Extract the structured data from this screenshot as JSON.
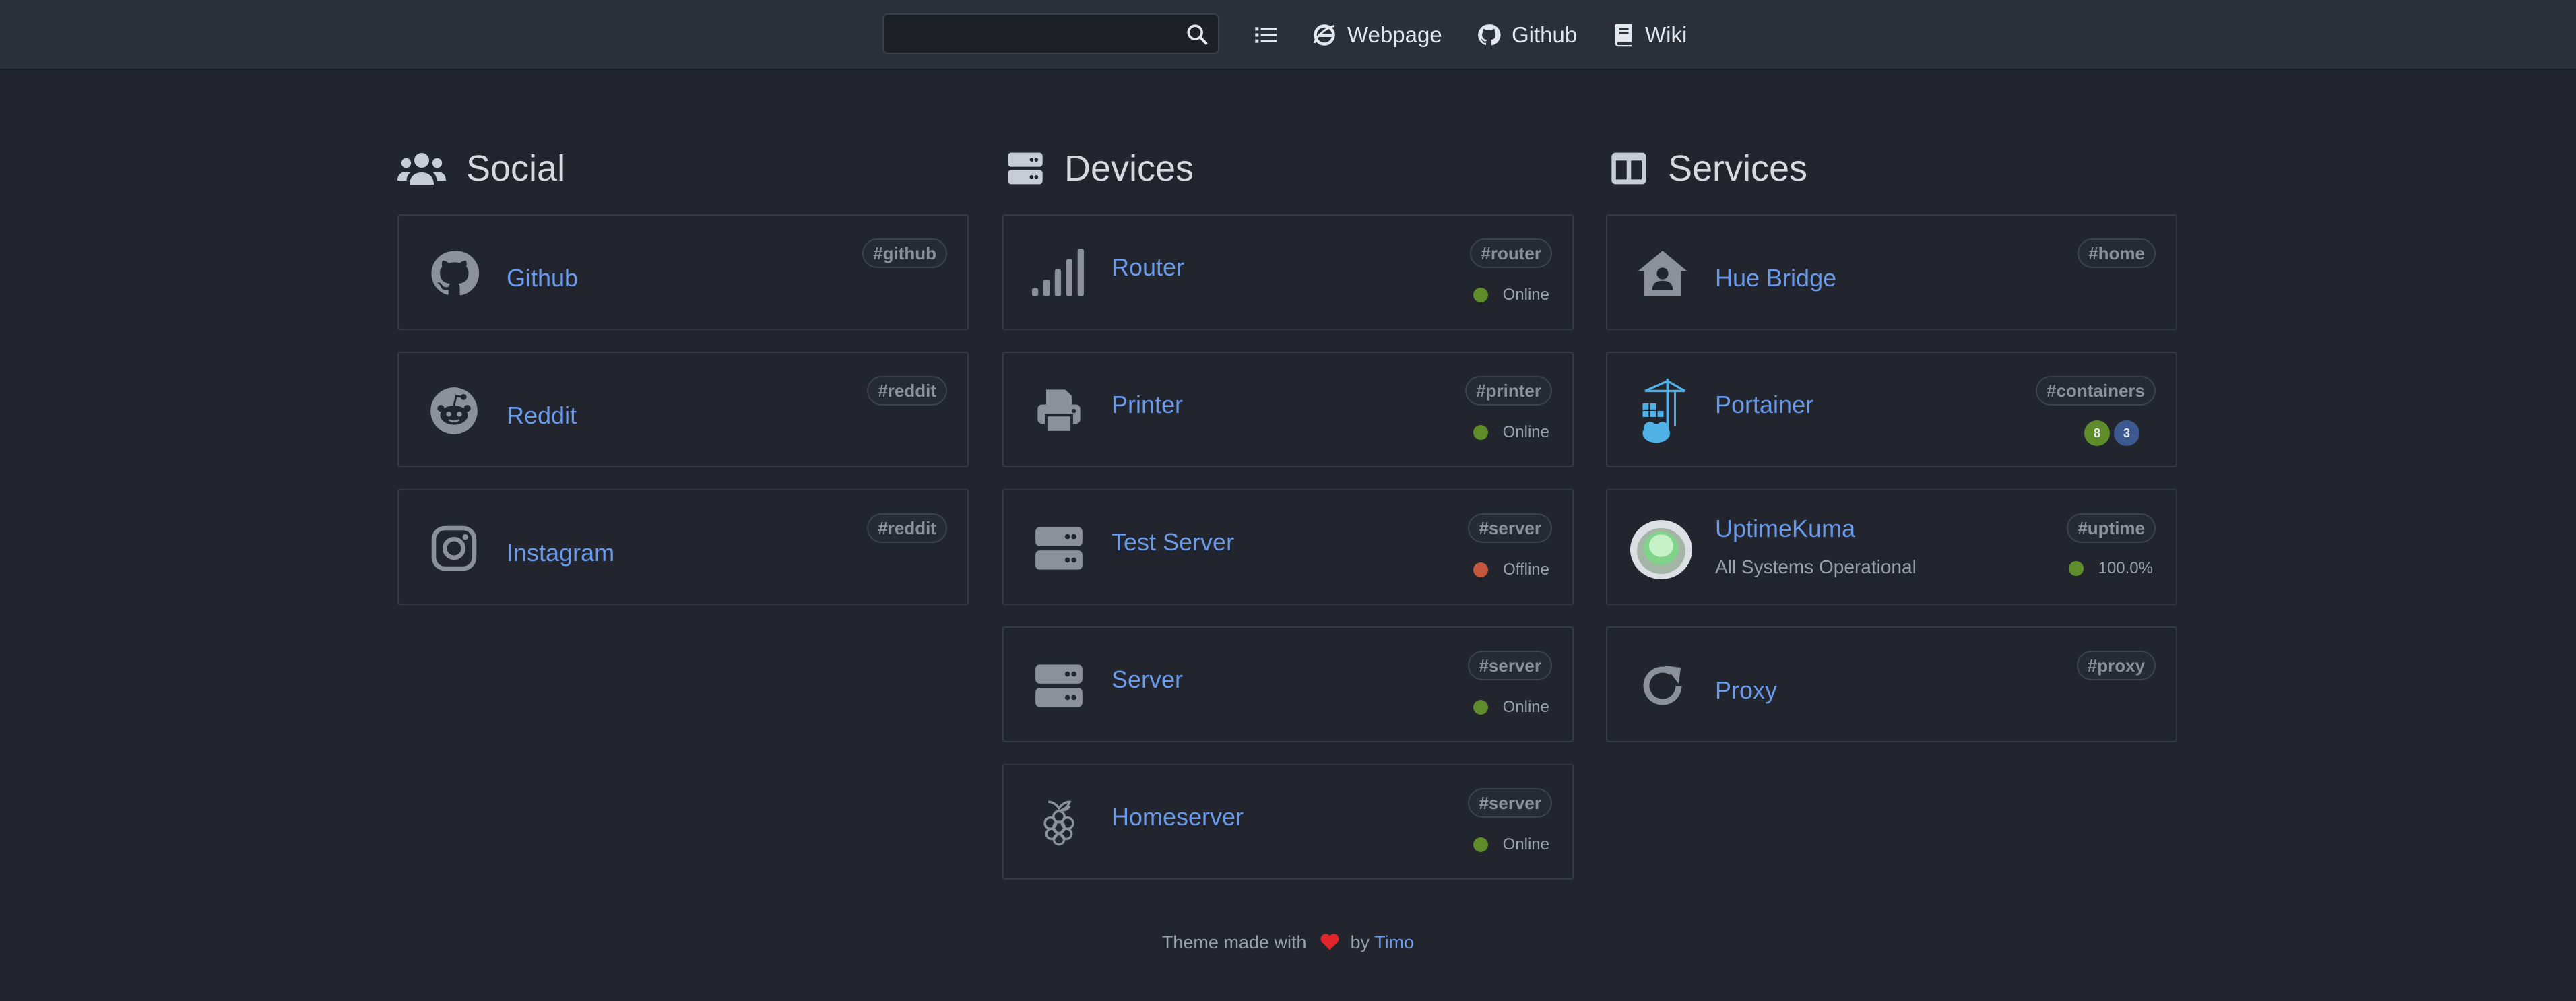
{
  "navbar": {
    "search_placeholder": "",
    "links": [
      {
        "label": "Webpage",
        "icon": "ie-globe-icon"
      },
      {
        "label": "Github",
        "icon": "github-icon"
      },
      {
        "label": "Wiki",
        "icon": "book-icon"
      }
    ]
  },
  "columns": [
    {
      "title": "Social",
      "icon": "users-icon",
      "cards": [
        {
          "name": "Github",
          "tag": "#github",
          "icon": "github-icon"
        },
        {
          "name": "Reddit",
          "tag": "#reddit",
          "icon": "reddit-icon"
        },
        {
          "name": "Instagram",
          "tag": "#reddit",
          "icon": "instagram-icon"
        }
      ]
    },
    {
      "title": "Devices",
      "icon": "server-icon",
      "cards": [
        {
          "name": "Router",
          "tag": "#router",
          "status": "Online",
          "icon": "signal-icon"
        },
        {
          "name": "Printer",
          "tag": "#printer",
          "status": "Online",
          "icon": "printer-icon"
        },
        {
          "name": "Test Server",
          "tag": "#server",
          "status": "Offline",
          "icon": "server-icon"
        },
        {
          "name": "Server",
          "tag": "#server",
          "status": "Online",
          "icon": "server-icon"
        },
        {
          "name": "Homeserver",
          "tag": "#server",
          "status": "Online",
          "icon": "raspberry-pi-icon"
        }
      ]
    },
    {
      "title": "Services",
      "icon": "columns-icon",
      "cards": [
        {
          "name": "Hue Bridge",
          "tag": "#home",
          "icon": "house-user-icon"
        },
        {
          "name": "Portainer",
          "tag": "#containers",
          "badges": [
            "8",
            "3"
          ],
          "icon": "portainer-icon"
        },
        {
          "name": "UptimeKuma",
          "tag": "#uptime",
          "subtitle": "All Systems Operational",
          "status": "100.0%",
          "icon": "uptime-kuma-icon"
        },
        {
          "name": "Proxy",
          "tag": "#proxy",
          "icon": "redo-icon"
        }
      ]
    }
  ],
  "footer": {
    "prefix": "Theme made with",
    "by": "by",
    "author": "Timo"
  },
  "colors": {
    "background": "#22252e",
    "navbar": "#2b2f39",
    "link": "#6a9ae8",
    "online": "#5f8d2c",
    "offline": "#c5573f",
    "badge_green": "#5f8d2c",
    "badge_blue": "#3c5a8f",
    "heart": "#e0262b"
  }
}
